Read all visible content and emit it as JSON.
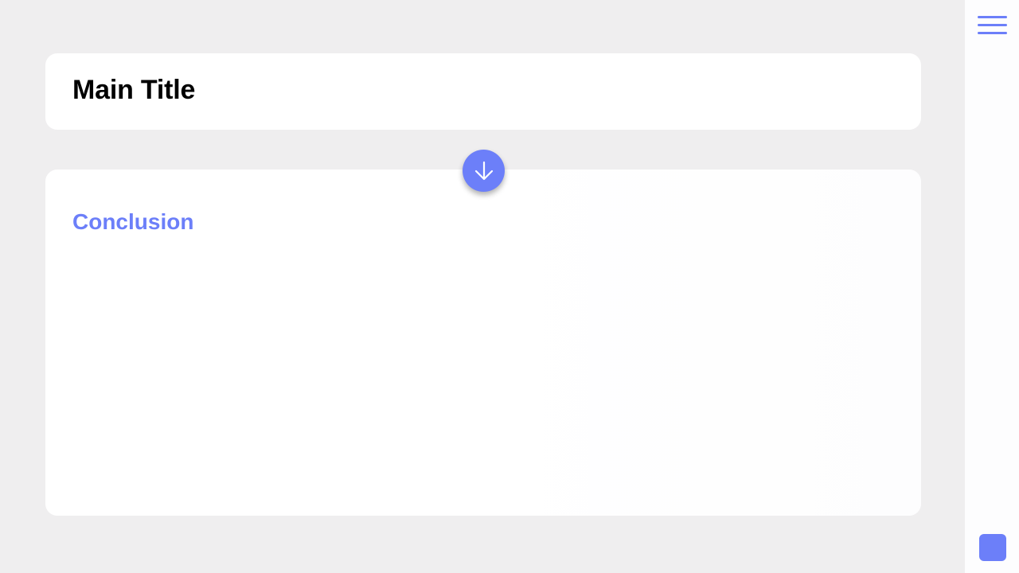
{
  "page": {
    "title": "Main Title",
    "section_label": "Conclusion"
  },
  "controls": {
    "menu_icon": "hamburger-menu-icon",
    "scroll_down_icon": "arrow-down-icon",
    "bottom_action_icon": "rounded-square-icon"
  },
  "colors": {
    "background": "#efeeef",
    "card": "#ffffff",
    "accent": "#6c7ff9",
    "text": "#000000",
    "rail": "#fdfdfe"
  }
}
